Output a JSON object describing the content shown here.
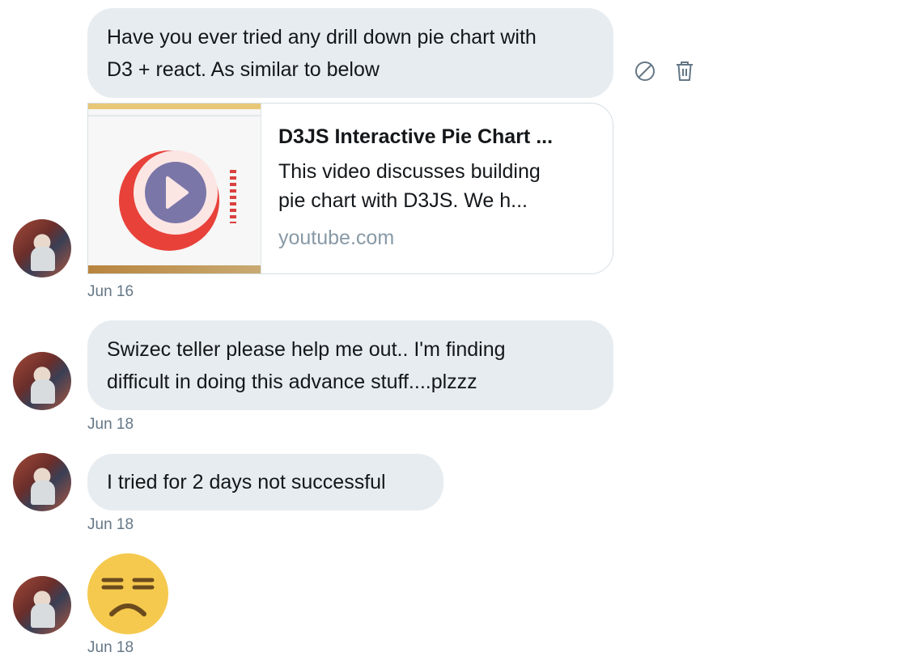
{
  "messages": [
    {
      "text_line1": "Have you ever tried any drill down pie chart with",
      "text_line2": "D3 + react. As similar to below",
      "date": "Jun 16",
      "card": {
        "title": "D3JS Interactive Pie Chart ...",
        "desc_line1": "This video discusses building",
        "desc_line2": "pie chart with D3JS. We h...",
        "domain": "youtube.com"
      }
    },
    {
      "text_line1": "Swizec teller please help me out.. I'm finding",
      "text_line2": "difficult in doing this advance stuff....plzzz",
      "date": "Jun 18"
    },
    {
      "text": "I tried for 2 days not successful",
      "date": "Jun 18"
    },
    {
      "emoji": "unamused-face",
      "date": "Jun 18"
    }
  ],
  "actions": {
    "block": "block-icon",
    "delete": "trash-icon"
  }
}
